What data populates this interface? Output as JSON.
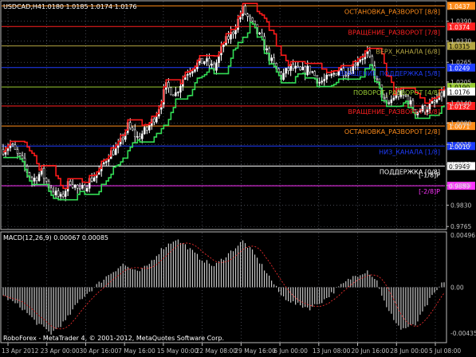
{
  "header": {
    "symbol": "USDCAD,H4",
    "ohlc": "1.0180 1.0185 1.0174 1.0176"
  },
  "macd_label": "MACD(12,26,9) 0.00067 0.00085",
  "footer": "RoboForex - MetaTrader 4, © 2001-2012, MetaQuotes Software Corp.",
  "colors": {
    "background": "#000000",
    "grid": "#6e7280",
    "axis": "#c0c0c0",
    "bull_candle": "#ffffff",
    "bear_candle": "#000000",
    "channel_red": "#ff1a1a",
    "channel_green": "#33dd55",
    "macd_hist": "#c8c8c8",
    "macd_signal": "#ff3030"
  },
  "chart_data": [
    {
      "type": "candlestick",
      "title": "USDCAD,H4",
      "ylim": [
        0.97583,
        1.04499
      ],
      "y_ticks": [
        "1.0390",
        "1.0330",
        "1.0265",
        "1.0205",
        "1.0140",
        "1.0080",
        "1.0015",
        "0.9955",
        "0.9890",
        "0.9830",
        "0.9765"
      ],
      "x_ticks": [
        "13 Apr 2012",
        "23 Apr 00:00",
        "30 Apr 16:00",
        "7 May 16:00",
        "15 May 00:00",
        "22 May 08:00",
        "29 May 16:00",
        "6 Jun 00:00",
        "13 Jun 08:00",
        "20 Jun 16:00",
        "28 Jun 00:00",
        "5 Jul 08:00"
      ],
      "current_price": "1.0176",
      "close_path": [
        [
          0,
          1.0
        ],
        [
          3,
          1.0015
        ],
        [
          8,
          0.996
        ],
        [
          12,
          0.9905
        ],
        [
          16,
          0.993
        ],
        [
          20,
          0.9875
        ],
        [
          24,
          0.985
        ],
        [
          28,
          0.9905
        ],
        [
          32,
          0.987
        ],
        [
          36,
          0.9905
        ],
        [
          40,
          0.993
        ],
        [
          44,
          0.9985
        ],
        [
          48,
          1.0005
        ],
        [
          52,
          1.007
        ],
        [
          56,
          1.0035
        ],
        [
          60,
          1.006
        ],
        [
          64,
          1.011
        ],
        [
          68,
          1.019
        ],
        [
          72,
          1.017
        ],
        [
          76,
          1.023
        ],
        [
          80,
          1.0255
        ],
        [
          84,
          1.027
        ],
        [
          88,
          1.0245
        ],
        [
          92,
          1.032
        ],
        [
          96,
          1.036
        ],
        [
          100,
          1.0425
        ],
        [
          104,
          1.038
        ],
        [
          108,
          1.033
        ],
        [
          112,
          1.0265
        ],
        [
          116,
          1.022
        ],
        [
          120,
          1.025
        ],
        [
          124,
          1.0235
        ],
        [
          128,
          1.0245
        ],
        [
          132,
          1.0205
        ],
        [
          136,
          1.0215
        ],
        [
          140,
          1.0245
        ],
        [
          144,
          1.0235
        ],
        [
          148,
          1.0275
        ],
        [
          152,
          1.029
        ],
        [
          156,
          1.0205
        ],
        [
          160,
          1.013
        ],
        [
          164,
          1.017
        ],
        [
          168,
          1.016
        ],
        [
          172,
          1.0115
        ],
        [
          176,
          1.0125
        ],
        [
          180,
          1.014
        ],
        [
          184,
          1.0176
        ]
      ],
      "levels": [
        {
          "label": "ОСТАНОВКА_РАЗВОРОТ [8/8]",
          "value": "1.0437",
          "color": "#ff8c1a"
        },
        {
          "label": "ВРАЩЕНИЕ_РАЗВОРОТ [7/8]",
          "value": "1.0374",
          "color": "#ff2020"
        },
        {
          "label": "ВЕРХ_КАНАЛА [6/8]",
          "value": "1.0315",
          "color": "#b5a642"
        },
        {
          "label": "ВРАЩЕНИЕ_ПОДДЕРЖКА [5/8]",
          "value": "1.0249",
          "color": "#1f3dff"
        },
        {
          "label": "ПОВОРОТ_РАЗВОРОТ [4/8]",
          "value": "1.0190",
          "color": "#9acd32"
        },
        {
          "label": "ВРАЩЕНИЕ_РАЗВОРОТ [3/8]",
          "value": "1.0132",
          "color": "#ff2020"
        },
        {
          "label": "ОСТАНОВКА_РАЗВОРОТ [2/8]",
          "value": "1.0071",
          "color": "#ff8c1a"
        },
        {
          "label": "НИЗ_КАНАЛА [1/8]",
          "value": "1.0010",
          "color": "#1f3dff"
        },
        {
          "label": "ПОДДЕРЖКА [0/8]",
          "value": "0.9949",
          "color": "#ffffff"
        },
        {
          "label": "[-1/8]P",
          "value": "0.9949",
          "color": "#ffffff"
        },
        {
          "label": "[-2/8]P",
          "value": "0.9889",
          "color": "#ff33ff"
        }
      ]
    },
    {
      "type": "bar",
      "title": "MACD(12,26,9) 0.00067 0.00085",
      "ylim": [
        -0.0052,
        0.0052
      ],
      "y_ticks": [
        "0.00496",
        "0.00",
        "-0.00435"
      ],
      "macd_path": [
        [
          0,
          -0.0008
        ],
        [
          8,
          -0.002
        ],
        [
          14,
          -0.0034
        ],
        [
          20,
          -0.0044
        ],
        [
          26,
          -0.0032
        ],
        [
          32,
          -0.0012
        ],
        [
          38,
          0.0
        ],
        [
          44,
          0.0012
        ],
        [
          50,
          0.0022
        ],
        [
          56,
          0.0014
        ],
        [
          60,
          0.002
        ],
        [
          66,
          0.0036
        ],
        [
          72,
          0.0046
        ],
        [
          76,
          0.004
        ],
        [
          82,
          0.0028
        ],
        [
          88,
          0.002
        ],
        [
          94,
          0.0032
        ],
        [
          100,
          0.0044
        ],
        [
          104,
          0.0034
        ],
        [
          110,
          0.0014
        ],
        [
          116,
          -0.0008
        ],
        [
          122,
          -0.0016
        ],
        [
          128,
          -0.002
        ],
        [
          134,
          -0.0012
        ],
        [
          140,
          0.0
        ],
        [
          146,
          0.001
        ],
        [
          152,
          0.0016
        ],
        [
          156,
          0.0006
        ],
        [
          160,
          -0.002
        ],
        [
          166,
          -0.004
        ],
        [
          172,
          -0.0036
        ],
        [
          178,
          -0.0012
        ],
        [
          184,
          0.0006
        ]
      ]
    }
  ]
}
